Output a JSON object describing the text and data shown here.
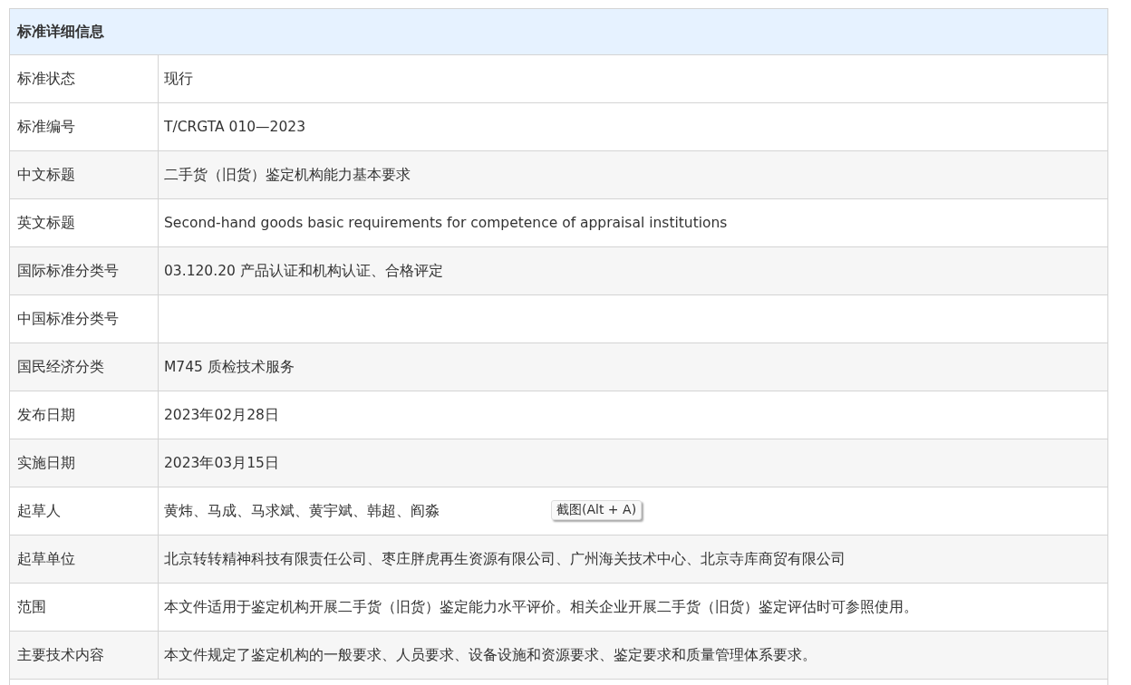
{
  "table": {
    "title": "标准详细信息",
    "rows": [
      {
        "label": "标准状态",
        "value": "现行"
      },
      {
        "label": "标准编号",
        "value": "T/CRGTA 010—2023"
      },
      {
        "label": "中文标题",
        "value": "二手货（旧货）鉴定机构能力基本要求"
      },
      {
        "label": "英文标题",
        "value": "Second-hand goods basic requirements for competence of appraisal institutions"
      },
      {
        "label": "国际标准分类号",
        "value": "03.120.20 产品认证和机构认证、合格评定"
      },
      {
        "label": "中国标准分类号"
      },
      {
        "label": "国民经济分类",
        "value": "M745 质检技术服务"
      },
      {
        "label": "发布日期",
        "value": "2023年02月28日"
      },
      {
        "label": "实施日期",
        "value": "2023年03月15日"
      },
      {
        "label": "起草人",
        "value": "黄炜、马成、马求斌、黄宇斌、韩超、阎淼"
      },
      {
        "label": "起草单位",
        "value": "北京转转精神科技有限责任公司、枣庄胖虎再生资源有限公司、广州海关技术中心、北京寺库商贸有限公司"
      },
      {
        "label": "范围",
        "value": "本文件适用于鉴定机构开展二手货（旧货）鉴定能力水平评价。相关企业开展二手货（旧货）鉴定评估时可参照使用。"
      },
      {
        "label": "主要技术内容",
        "value": "本文件规定了鉴定机构的一般要求、人员要求、设备设施和资源要求、鉴定要求和质量管理体系要求。"
      }
    ]
  },
  "tooltip": {
    "text": "截图(Alt + A)"
  }
}
